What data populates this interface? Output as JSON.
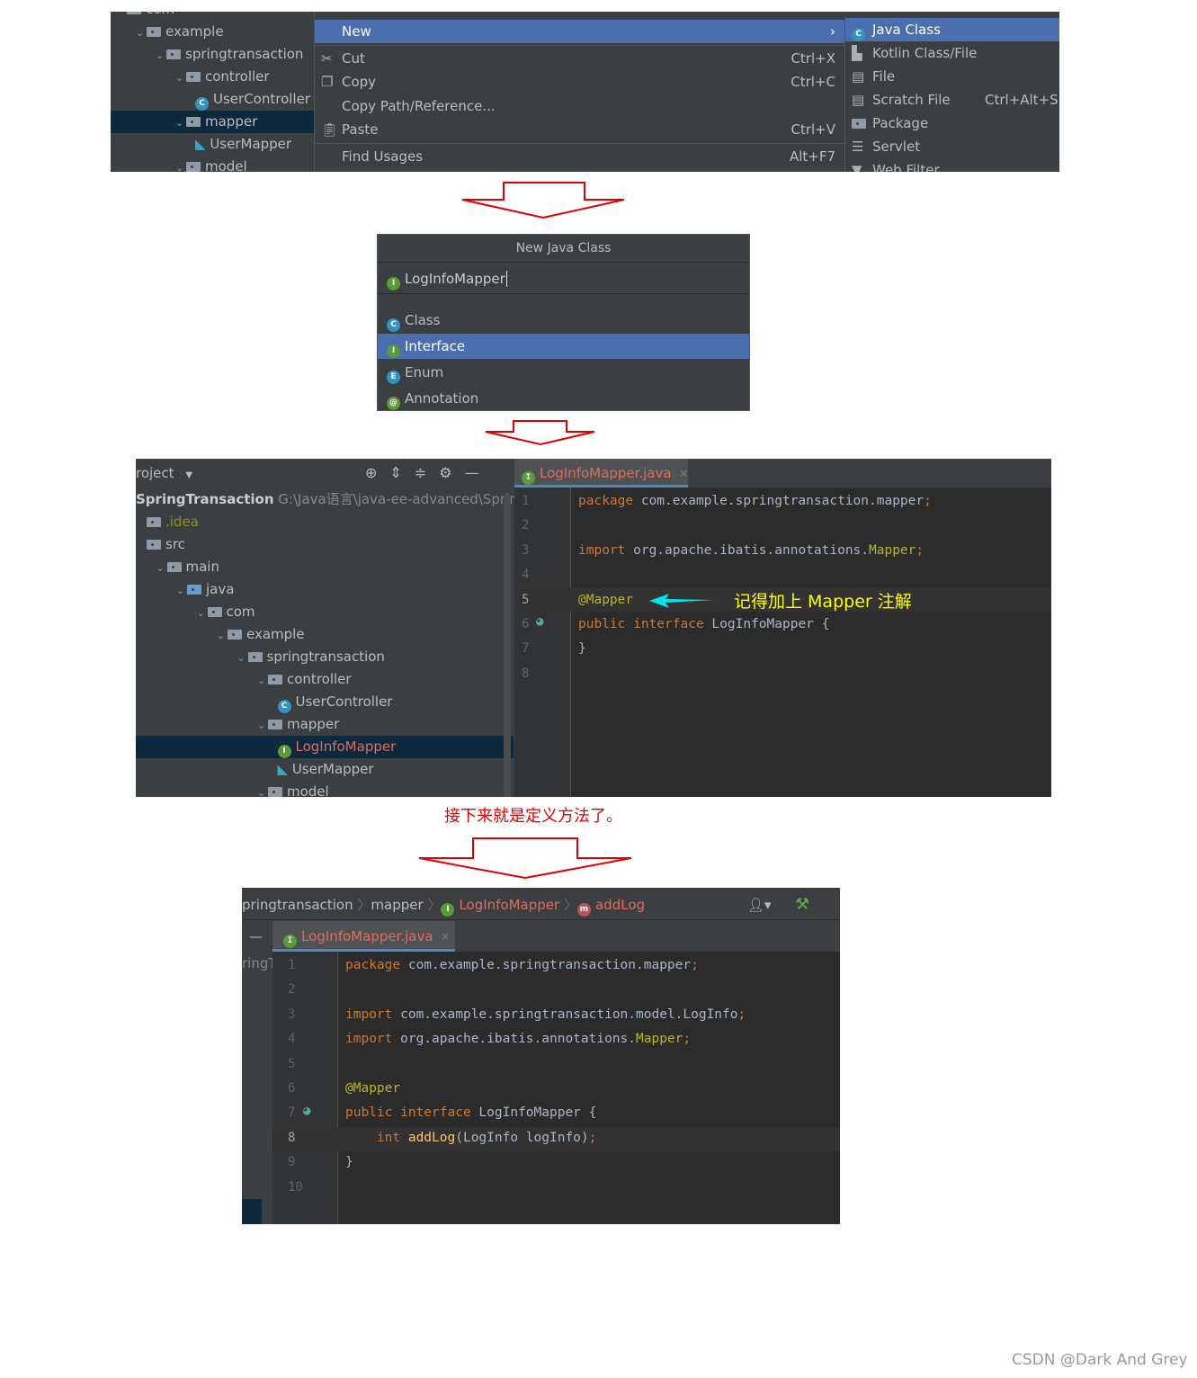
{
  "step1": {
    "tree": [
      {
        "label": "com",
        "indent": 0
      },
      {
        "label": "example",
        "indent": 1,
        "chev": true
      },
      {
        "label": "springtransaction",
        "indent": 2,
        "chev": true
      },
      {
        "label": "controller",
        "indent": 3,
        "chev": true
      },
      {
        "label": "UserController",
        "indent": 4,
        "icon": "class"
      },
      {
        "label": "mapper",
        "indent": 3,
        "chev": true,
        "selected": true
      },
      {
        "label": "UserMapper",
        "indent": 4,
        "icon": "mybatis"
      },
      {
        "label": "model",
        "indent": 3,
        "chev": true
      }
    ],
    "menu": {
      "new": "New",
      "cut": "Cut",
      "cut_sc": "Ctrl+X",
      "copy": "Copy",
      "copy_sc": "Ctrl+C",
      "copy_path": "Copy Path/Reference...",
      "paste": "Paste",
      "paste_sc": "Ctrl+V",
      "find": "Find Usages",
      "find_sc": "Alt+F7"
    },
    "submenu": {
      "java_class": "Java Class",
      "kotlin": "Kotlin Class/File",
      "file": "File",
      "scratch": "Scratch File",
      "scratch_sc": "Ctrl+Alt+Sh",
      "package": "Package",
      "servlet": "Servlet",
      "web_filter": "Web Filter"
    }
  },
  "step2": {
    "title": "New Java Class",
    "name_value": "LogInfoMapper",
    "options": [
      {
        "label": "Class",
        "letter": "C",
        "type": "c"
      },
      {
        "label": "Interface",
        "letter": "I",
        "type": "i",
        "selected": true
      },
      {
        "label": "Enum",
        "letter": "E",
        "type": "e"
      },
      {
        "label": "Annotation",
        "letter": "@",
        "type": "a"
      }
    ]
  },
  "step3": {
    "project_label": "roject",
    "root": "SpringTransaction",
    "root_path": "G:\\Java语言\\java-ee-advanced\\SpringT",
    "tree": [
      {
        "label": ".idea",
        "indent": 0,
        "plain": true,
        "color": "#8c8c2a"
      },
      {
        "label": "src",
        "indent": 0,
        "plain": true
      },
      {
        "label": "main",
        "indent": 1,
        "chev": true,
        "plain": true
      },
      {
        "label": "java",
        "indent": 2,
        "chev": true,
        "plain": true,
        "blue": true
      },
      {
        "label": "com",
        "indent": 3,
        "chev": true
      },
      {
        "label": "example",
        "indent": 4,
        "chev": true
      },
      {
        "label": "springtransaction",
        "indent": 5,
        "chev": true
      },
      {
        "label": "controller",
        "indent": 6,
        "chev": true
      },
      {
        "label": "UserController",
        "indent": 7,
        "icon": "class"
      },
      {
        "label": "mapper",
        "indent": 6,
        "chev": true
      },
      {
        "label": "LogInfoMapper",
        "indent": 7,
        "icon": "interface",
        "selected": true,
        "color": "#e06c5e"
      },
      {
        "label": "UserMapper",
        "indent": 7,
        "icon": "mybatis"
      },
      {
        "label": "model",
        "indent": 6,
        "chev": true
      }
    ],
    "tab": "LogInfoMapper.java",
    "line_numbers": [
      "1",
      "2",
      "3",
      "4",
      "5",
      "6",
      "7",
      "8"
    ],
    "code": [
      [
        [
          "package",
          "kw"
        ],
        [
          " com.example.springtransaction.mapper",
          ""
        ],
        [
          ";",
          "kw"
        ]
      ],
      [],
      [
        [
          "import",
          "kw"
        ],
        [
          " org.apache.ibatis.annotations.",
          ""
        ],
        [
          "Mapper",
          "an"
        ],
        [
          ";",
          "kw"
        ]
      ],
      [],
      [
        [
          "@Mapper",
          "an"
        ]
      ],
      [
        [
          "public interface",
          "kw"
        ],
        [
          " LogInfoMapper {",
          ""
        ]
      ],
      [
        [
          "}",
          ""
        ]
      ],
      []
    ],
    "annotation": "记得加上 Mapper 注解",
    "annotation_color": "#ffff00",
    "arrow_color": "#00e5ee"
  },
  "caption": "接下来就是定义方法了。",
  "step4": {
    "breadcrumb": [
      "pringtransaction",
      "mapper",
      "LogInfoMapper",
      "addLog"
    ],
    "tab": "LogInfoMapper.java",
    "side_text": "ringT",
    "line_numbers": [
      "1",
      "2",
      "3",
      "4",
      "5",
      "6",
      "7",
      "8",
      "9",
      "10"
    ],
    "code": [
      [
        [
          "package",
          "kw"
        ],
        [
          " com.example.springtransaction.mapper",
          ""
        ],
        [
          ";",
          "kw"
        ]
      ],
      [],
      [
        [
          "import",
          "kw"
        ],
        [
          " com.example.springtransaction.model.LogInfo",
          ""
        ],
        [
          ";",
          "kw"
        ]
      ],
      [
        [
          "import",
          "kw"
        ],
        [
          " org.apache.ibatis.annotations.",
          ""
        ],
        [
          "Mapper",
          "an"
        ],
        [
          ";",
          "kw"
        ]
      ],
      [],
      [
        [
          "@Mapper",
          "an"
        ]
      ],
      [
        [
          "public interface",
          "kw"
        ],
        [
          " LogInfoMapper {",
          ""
        ]
      ],
      [
        [
          "    int ",
          "kw"
        ],
        [
          "addLog",
          "mt"
        ],
        [
          "(LogInfo logInfo)",
          ""
        ],
        [
          ";",
          "kw"
        ]
      ],
      [
        [
          "}",
          ""
        ]
      ],
      []
    ]
  },
  "watermark": "CSDN @Dark And Grey",
  "colors": {
    "selection": "#4b6eaf",
    "arrow_red": "#e00000",
    "error_name": "#e06c5e"
  }
}
